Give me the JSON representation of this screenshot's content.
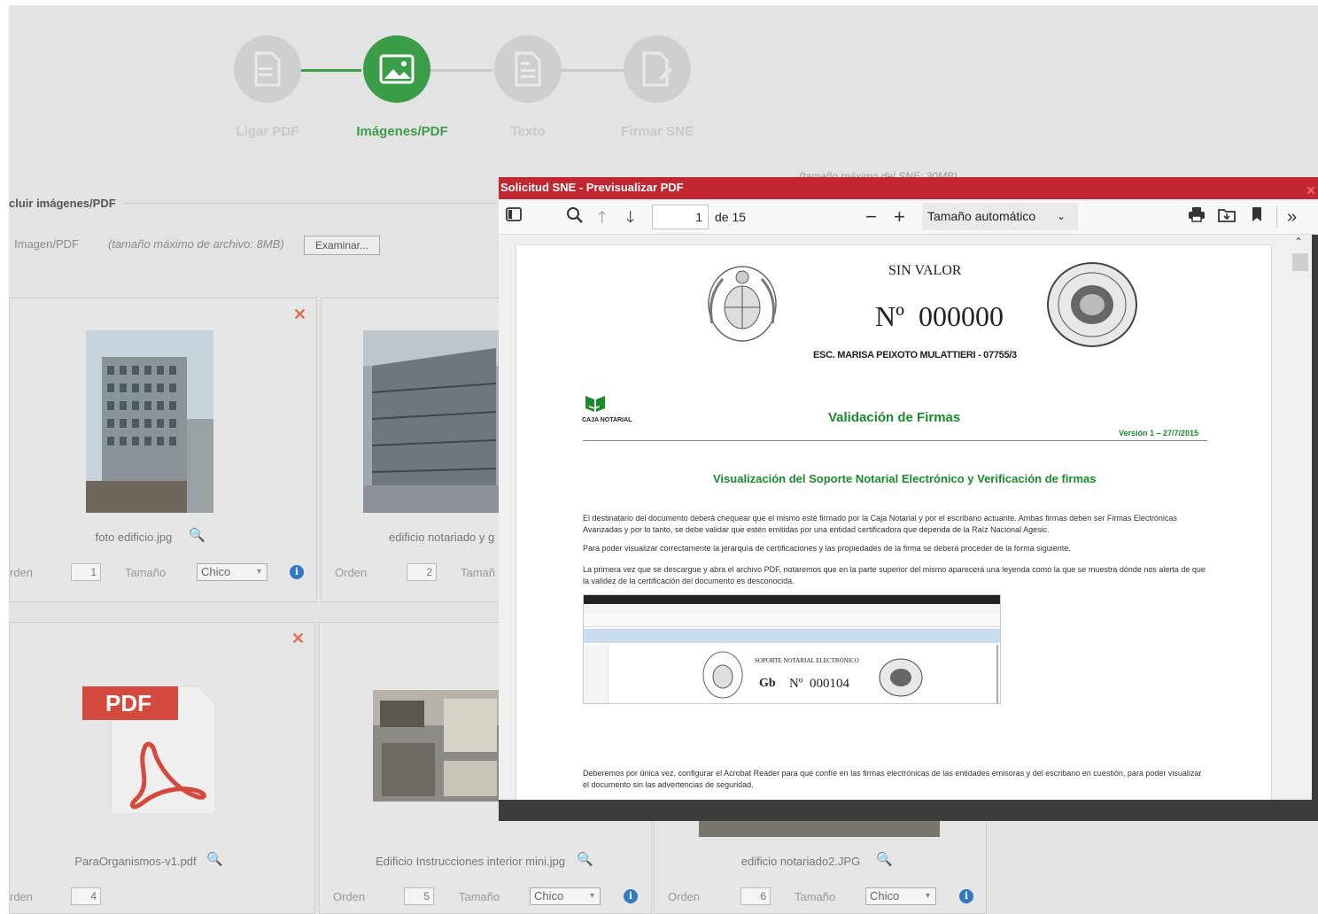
{
  "stepper": {
    "steps": [
      {
        "label": "Ligar PDF",
        "icon": "pdf-document-icon",
        "active": false
      },
      {
        "label": "Imágenes/PDF",
        "icon": "image-icon",
        "active": true
      },
      {
        "label": "Texto",
        "icon": "text-document-icon",
        "active": false
      },
      {
        "label": "Firmar SNE",
        "icon": "sign-document-icon",
        "active": false
      }
    ]
  },
  "include_section": {
    "legend": "cluir imágenes/PDF",
    "field_label": "Imagen/PDF",
    "max_size_hint": "(tamaño máximo de archivo: 8MB)",
    "browse_button": "Examinar...",
    "sne_hint": "(tamaño máximo del SNE: 30MB)"
  },
  "cards": [
    {
      "file_name": "foto edificio.jpg",
      "order_label": "rden",
      "order": "1",
      "size_label": "Tamaño",
      "size": "Chico"
    },
    {
      "file_name": "edificio notariado y g",
      "order_label": "Orden",
      "order": "2",
      "size_label": "Tamañ",
      "size": ""
    },
    {
      "file_name": "ParaOrganismos-v1.pdf",
      "order_label": "rden",
      "order": "4",
      "size_label": "",
      "size": "",
      "thumb_text": "PDF"
    },
    {
      "file_name": "Edificio Instrucciones interior mini.jpg",
      "order_label": "Orden",
      "order": "5",
      "size_label": "Tamaño",
      "size": "Chico"
    },
    {
      "file_name": "edificio notariado2.JPG",
      "order_label": "Orden",
      "order": "6",
      "size_label": "Tamaño",
      "size": "Chico"
    }
  ],
  "modal": {
    "title": "Solicitud SNE - Previsualizar PDF",
    "toolbar": {
      "page": "1",
      "of_pages": "de 15",
      "zoom": "Tamaño automático"
    },
    "document": {
      "sin_valor": "SIN VALOR",
      "number": "Nº  000000",
      "escribano": "ESC. MARISA PEIXOTO MULATTIERI - 07755/3",
      "seal_text": "REPUBLICA ORIENTAL DEL URUGUAY",
      "logo_caption": "CAJA NOTARIAL",
      "heading": "Validación de Firmas",
      "version": "Versión 1 – 27/7/2015",
      "subtitle": "Visualización del Soporte Notarial Electrónico y Verificación de firmas",
      "p1": "El destinatario del documento deberá chequear que el mismo esté firmado por la Caja Notarial y por el escribano actuante. Ambas firmas deben ser Firmas Electrónicas Avanzadas y por lo tanto, se debe validar que estén emitidas por una entidad certificadora que dependa de la Raíz Nacional Agesic.",
      "p2": "Para poder visualizar correctamente la jerarquía de certificaciones y las propiedades de la firma se deberá proceder de la forma siguiente.",
      "p3": "La primera vez que se descargue y abra el archivo PDF, notaremos que en la parte superior del mismo aparecerá una leyenda como la que se muestra dónde nos alerta de que la validez de la certificación del documento es desconocida.",
      "shot_title": "SOPORTE NOTARIAL ELECTRÓNICO",
      "shot_logo": "Gb",
      "shot_number": "Nº  000104",
      "p4": "Deberemos por única vez, configurar el Acrobat Reader para que confíe en las firmas electrónicas de las entidades emisoras y del escribano en cuestión, para poder visualizar el documento sin las advertencias de seguridad."
    }
  },
  "colors": {
    "active_step": "#3c9d48",
    "modal_title_bg": "#c22630",
    "doc_green": "#1a8a2c"
  }
}
